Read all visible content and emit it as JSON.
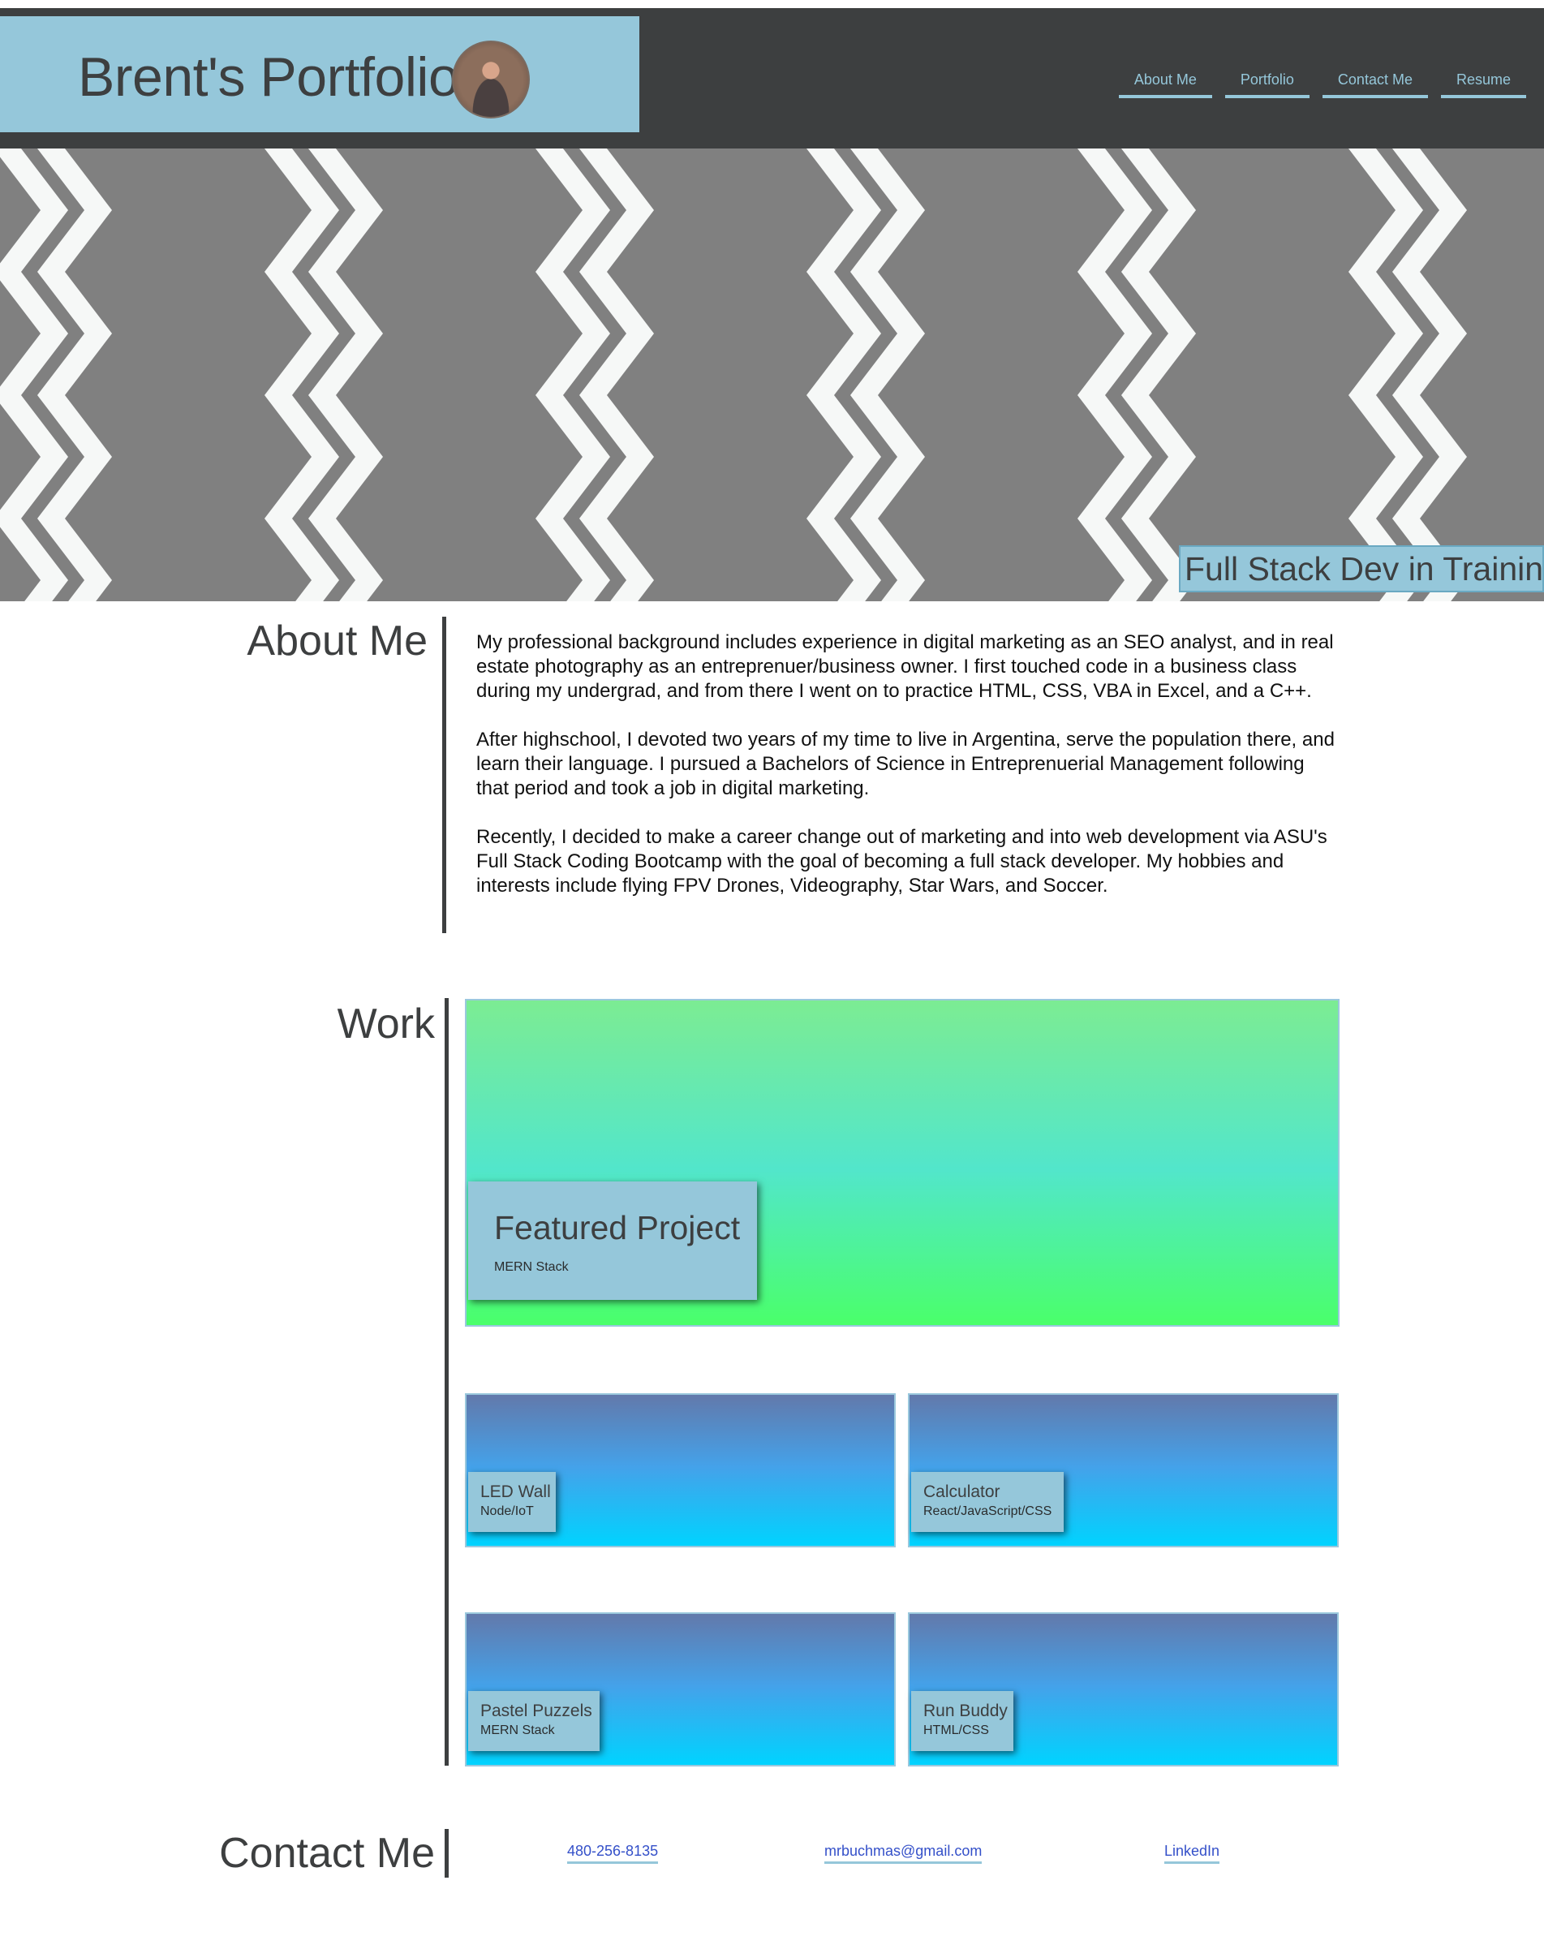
{
  "header": {
    "title": "Brent's Portfolio",
    "nav": [
      "About Me",
      "Portfolio",
      "Contact Me",
      "Resume"
    ]
  },
  "hero": {
    "tagline": "Full Stack Dev in Training"
  },
  "about": {
    "heading": "About Me",
    "paragraphs": [
      "My professional background includes experience in digital marketing as an SEO analyst, and in real estate photography as an entreprenuer/business owner. I first touched code in a business class during my undergrad, and from there I went on to practice HTML, CSS, VBA in Excel, and a C++.",
      "After highschool, I devoted two years of my time to live in Argentina, serve the population there, and learn their language. I pursued a Bachelors of Science in Entreprenuerial Management following that period and took a job in digital marketing.",
      "Recently, I decided to make a career change out of marketing and into web development via ASU's Full Stack Coding Bootcamp with the goal of becoming a full stack developer. My hobbies and interests include flying FPV Drones, Videography, Star Wars, and Soccer."
    ]
  },
  "work": {
    "heading": "Work",
    "featured": {
      "title": "Featured Project",
      "stack": "MERN Stack"
    },
    "projects": [
      {
        "title": "LED Wall",
        "stack": "Node/IoT"
      },
      {
        "title": "Calculator",
        "stack": "React/JavaScript/CSS"
      },
      {
        "title": "Pastel Puzzels",
        "stack": "MERN Stack"
      },
      {
        "title": "Run Buddy",
        "stack": "HTML/CSS"
      }
    ]
  },
  "contact": {
    "heading": "Contact Me",
    "phone": "480-256-8135",
    "email": "mrbuchmas@gmail.com",
    "linkedin": "LinkedIn"
  },
  "colors": {
    "accent": "#95c7da",
    "header_bg": "#3d3f40",
    "hero_bg": "#808080",
    "link": "#3450c9"
  }
}
